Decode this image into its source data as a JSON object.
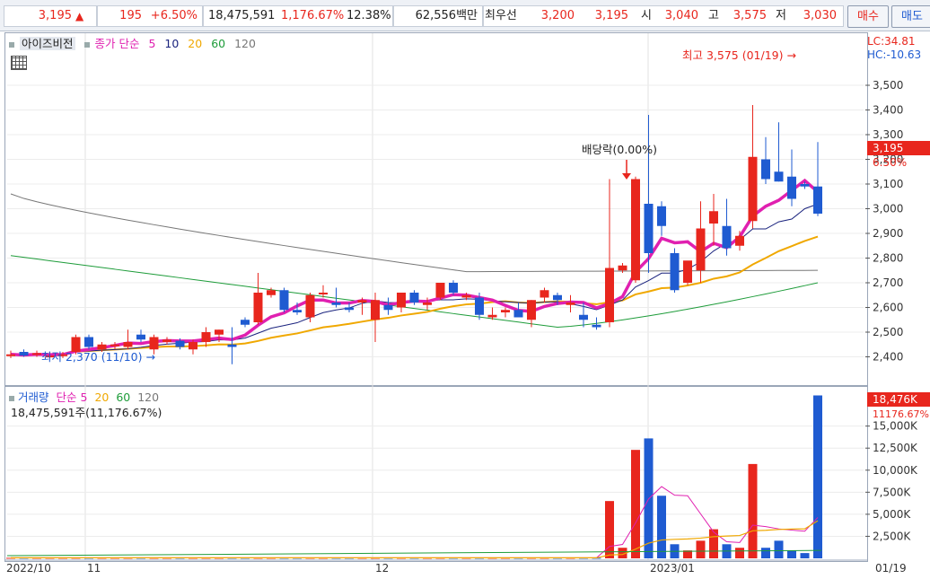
{
  "ticker": {
    "price": "3,195",
    "arrow": "▲",
    "change": "195",
    "change_pct": "+6.50%",
    "volume": "18,475,591",
    "volume_ratio": "1,176.67%",
    "turnover_rate": "12.38%",
    "amount": "62,556백만",
    "best_ask_label": "최우선",
    "best_ask": "3,200",
    "best_bid": "3,195",
    "open_label": "시",
    "open": "3,040",
    "high_label": "고",
    "high": "3,575",
    "low_label": "저",
    "low": "3,030",
    "buy_label": "매수",
    "sell_label": "매도"
  },
  "price_panel": {
    "stock_name": "아이즈비전",
    "ma_label": "종가 단순",
    "ma_periods": [
      "5",
      "10",
      "20",
      "60",
      "120"
    ],
    "lc_label": "LC:34.81",
    "hc_label": "HC:-10.63",
    "last_price_tag": "3,195",
    "last_pct_tag": "6.50%",
    "high_annotation": "최고 3,575 (01/19)",
    "low_annotation": "최저 2,370 (11/10)",
    "dividend_annotation": "배당락(0.00%)",
    "y_ticks": [
      "3,500",
      "3,400",
      "3,300",
      "3,200",
      "3,100",
      "3,000",
      "2,900",
      "2,800",
      "2,700",
      "2,600",
      "2,500",
      "2,400"
    ]
  },
  "volume_panel": {
    "title": "거래량",
    "ma_label": "단순",
    "ma_periods": [
      "5",
      "20",
      "60",
      "120"
    ],
    "summary": "18,475,591주(11,176.67%)",
    "last_vol_tag": "18,476K",
    "last_ratio_tag": "11176.67%",
    "y_ticks": [
      "15,000K",
      "12,500K",
      "10,000K",
      "7,500K",
      "5,000K",
      "2,500K"
    ]
  },
  "x_axis": {
    "labels": [
      "2022/10",
      "11",
      "12",
      "2023/01"
    ],
    "cursor_date": "01/19"
  },
  "colors": {
    "up": "#e8261d",
    "down": "#1f5bd1",
    "ma5": "#e020b0",
    "ma10": "#1a237e",
    "ma20": "#f0a800",
    "ma60": "#1e9c3a",
    "ma120": "#777777"
  },
  "chart_data": {
    "type": "candlestick",
    "title": "아이즈비전",
    "x": [
      "d1",
      "d2",
      "d3",
      "d4",
      "d5",
      "d6",
      "d7",
      "d8",
      "d9",
      "d10",
      "d11",
      "d12",
      "d13",
      "d14",
      "d15",
      "d16",
      "d17",
      "d18",
      "d19",
      "d20",
      "d21",
      "d22",
      "d23",
      "d24",
      "d25",
      "d26",
      "d27",
      "d28",
      "d29",
      "d30",
      "d31",
      "d32",
      "d33",
      "d34",
      "d35",
      "d36",
      "d37",
      "d38",
      "d39",
      "d40",
      "d41",
      "d42",
      "d43",
      "d44",
      "d45",
      "d46",
      "d47",
      "d48",
      "d49",
      "d50",
      "d51",
      "d52",
      "d53",
      "d54",
      "d55",
      "d56",
      "d57",
      "d58",
      "d59",
      "d60",
      "d61",
      "d62",
      "d63"
    ],
    "ohlc": [
      [
        2405,
        2425,
        2395,
        2410
      ],
      [
        2420,
        2430,
        2400,
        2405
      ],
      [
        2415,
        2425,
        2400,
        2415
      ],
      [
        2405,
        2420,
        2395,
        2405
      ],
      [
        2410,
        2420,
        2395,
        2410
      ],
      [
        2420,
        2490,
        2410,
        2480
      ],
      [
        2480,
        2490,
        2430,
        2440
      ],
      [
        2430,
        2460,
        2420,
        2450
      ],
      [
        2450,
        2460,
        2430,
        2450
      ],
      [
        2440,
        2510,
        2430,
        2460
      ],
      [
        2490,
        2510,
        2460,
        2470
      ],
      [
        2430,
        2490,
        2410,
        2480
      ],
      [
        2460,
        2480,
        2450,
        2470
      ],
      [
        2465,
        2475,
        2430,
        2440
      ],
      [
        2430,
        2470,
        2410,
        2460
      ],
      [
        2460,
        2520,
        2440,
        2500
      ],
      [
        2490,
        2510,
        2460,
        2510
      ],
      [
        2450,
        2520,
        2370,
        2440
      ],
      [
        2550,
        2560,
        2520,
        2530
      ],
      [
        2540,
        2740,
        2530,
        2660
      ],
      [
        2650,
        2680,
        2640,
        2670
      ],
      [
        2670,
        2680,
        2580,
        2590
      ],
      [
        2590,
        2620,
        2570,
        2580
      ],
      [
        2560,
        2660,
        2540,
        2650
      ],
      [
        2660,
        2690,
        2640,
        2660
      ],
      [
        2620,
        2680,
        2600,
        2610
      ],
      [
        2600,
        2620,
        2580,
        2590
      ],
      [
        2620,
        2640,
        2570,
        2630
      ],
      [
        2550,
        2660,
        2460,
        2630
      ],
      [
        2610,
        2640,
        2570,
        2590
      ],
      [
        2600,
        2650,
        2580,
        2660
      ],
      [
        2660,
        2670,
        2610,
        2620
      ],
      [
        2610,
        2640,
        2590,
        2620
      ],
      [
        2640,
        2700,
        2630,
        2700
      ],
      [
        2700,
        2710,
        2650,
        2660
      ],
      [
        2640,
        2660,
        2630,
        2650
      ],
      [
        2640,
        2660,
        2550,
        2570
      ],
      [
        2560,
        2600,
        2550,
        2570
      ],
      [
        2580,
        2600,
        2560,
        2590
      ],
      [
        2590,
        2620,
        2560,
        2560
      ],
      [
        2550,
        2630,
        2520,
        2630
      ],
      [
        2640,
        2680,
        2620,
        2670
      ],
      [
        2650,
        2660,
        2610,
        2630
      ],
      [
        2610,
        2650,
        2580,
        2620
      ],
      [
        2570,
        2620,
        2520,
        2550
      ],
      [
        2530,
        2560,
        2510,
        2520
      ],
      [
        2540,
        3120,
        2520,
        2760
      ],
      [
        2750,
        2780,
        2740,
        2770
      ],
      [
        2710,
        3130,
        2700,
        3120
      ],
      [
        3020,
        3380,
        2740,
        2820
      ],
      [
        3010,
        3030,
        2890,
        2930
      ],
      [
        2820,
        2840,
        2660,
        2670
      ],
      [
        2700,
        2780,
        2690,
        2790
      ],
      [
        2750,
        3030,
        2700,
        2920
      ],
      [
        2940,
        3060,
        2850,
        2990
      ],
      [
        2930,
        3040,
        2810,
        2840
      ],
      [
        2850,
        2910,
        2830,
        2890
      ],
      [
        2950,
        3420,
        2920,
        3210
      ],
      [
        3200,
        3290,
        3100,
        3120
      ],
      [
        3150,
        3350,
        3110,
        3110
      ],
      [
        3130,
        3240,
        3010,
        3040
      ],
      [
        3100,
        3110,
        3080,
        3090
      ],
      [
        3090,
        3270,
        2970,
        2980
      ]
    ],
    "volume_k": [
      60,
      60,
      60,
      60,
      60,
      60,
      60,
      60,
      60,
      60,
      60,
      60,
      60,
      60,
      60,
      60,
      60,
      60,
      60,
      60,
      60,
      60,
      60,
      60,
      60,
      60,
      60,
      60,
      60,
      60,
      60,
      60,
      60,
      60,
      60,
      60,
      60,
      60,
      60,
      60,
      60,
      60,
      60,
      60,
      60,
      60,
      6500,
      1200,
      12300,
      13600,
      7100,
      1600,
      900,
      2000,
      3300,
      1600,
      1200,
      10700,
      1200,
      2000,
      900,
      600,
      18476
    ],
    "ylim": [
      2300,
      3700
    ],
    "volume_ylim": [
      0,
      17000
    ]
  }
}
